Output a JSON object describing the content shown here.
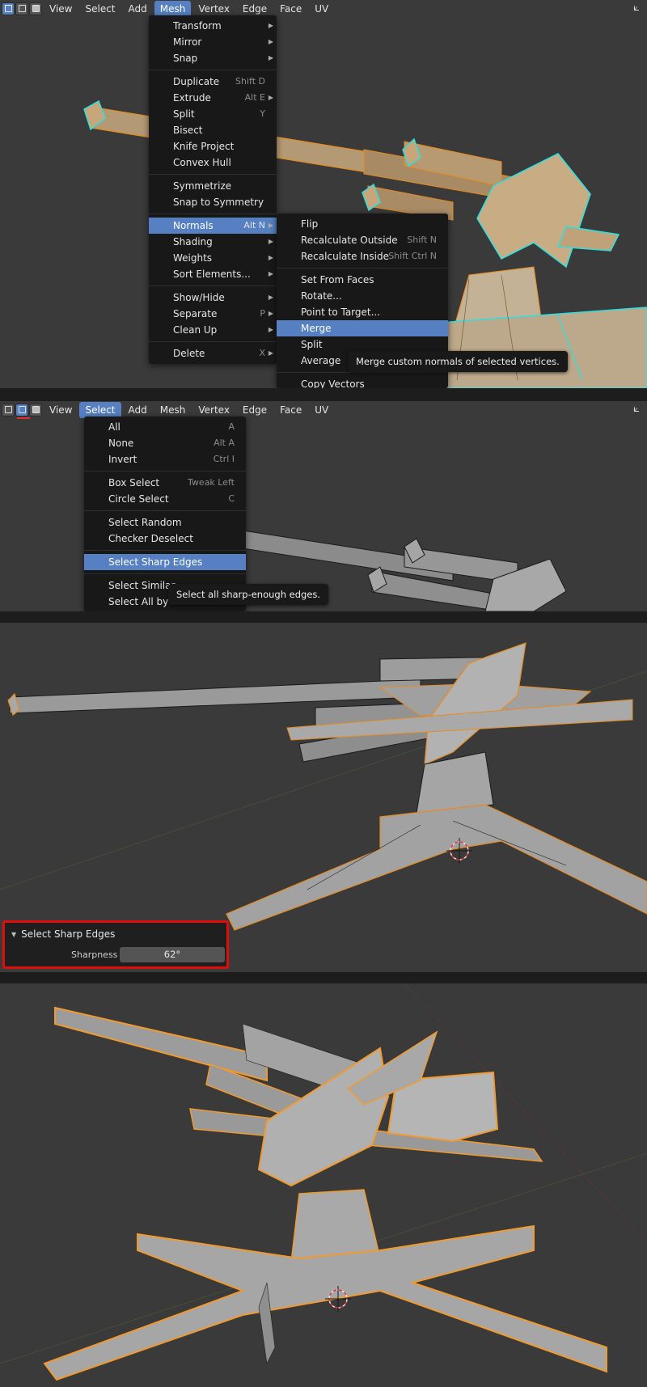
{
  "panel1": {
    "header_menus": [
      "View",
      "Select",
      "Add",
      "Mesh",
      "Vertex",
      "Edge",
      "Face",
      "UV"
    ],
    "open_menu": "Mesh",
    "mesh_menu": [
      {
        "label": "Transform",
        "shortcut": "",
        "submenu": true
      },
      {
        "label": "Mirror",
        "shortcut": "",
        "submenu": true
      },
      {
        "label": "Snap",
        "shortcut": "",
        "submenu": true
      },
      {
        "sep": true
      },
      {
        "label": "Duplicate",
        "shortcut": "Shift D",
        "submenu": false
      },
      {
        "label": "Extrude",
        "shortcut": "Alt E",
        "submenu": true
      },
      {
        "label": "Split",
        "shortcut": "Y",
        "submenu": false
      },
      {
        "label": "Bisect",
        "shortcut": "",
        "submenu": false
      },
      {
        "label": "Knife Project",
        "shortcut": "",
        "submenu": false
      },
      {
        "label": "Convex Hull",
        "shortcut": "",
        "submenu": false
      },
      {
        "sep": true
      },
      {
        "label": "Symmetrize",
        "shortcut": "",
        "submenu": false
      },
      {
        "label": "Snap to Symmetry",
        "shortcut": "",
        "submenu": false
      },
      {
        "sep": true
      },
      {
        "label": "Normals",
        "shortcut": "Alt N",
        "submenu": true,
        "highlight": true
      },
      {
        "label": "Shading",
        "shortcut": "",
        "submenu": true
      },
      {
        "label": "Weights",
        "shortcut": "",
        "submenu": true
      },
      {
        "label": "Sort Elements...",
        "shortcut": "",
        "submenu": true
      },
      {
        "sep": true
      },
      {
        "label": "Show/Hide",
        "shortcut": "",
        "submenu": true
      },
      {
        "label": "Separate",
        "shortcut": "P",
        "submenu": true
      },
      {
        "label": "Clean Up",
        "shortcut": "",
        "submenu": true
      },
      {
        "sep": true
      },
      {
        "label": "Delete",
        "shortcut": "X",
        "submenu": true
      }
    ],
    "normals_menu": [
      {
        "label": "Flip",
        "shortcut": ""
      },
      {
        "label": "Recalculate Outside",
        "shortcut": "Shift N"
      },
      {
        "label": "Recalculate Inside",
        "shortcut": "Shift Ctrl N"
      },
      {
        "sep": true
      },
      {
        "label": "Set From Faces",
        "shortcut": ""
      },
      {
        "label": "Rotate...",
        "shortcut": ""
      },
      {
        "label": "Point to Target...",
        "shortcut": ""
      },
      {
        "label": "Merge",
        "shortcut": "",
        "highlight": true
      },
      {
        "label": "Split",
        "shortcut": ""
      },
      {
        "label": "Average",
        "shortcut": ""
      },
      {
        "sep": true
      },
      {
        "label": "Copy Vectors",
        "shortcut": ""
      }
    ],
    "tooltip": "Merge custom normals of selected vertices."
  },
  "panel2": {
    "header_menus": [
      "View",
      "Select",
      "Add",
      "Mesh",
      "Vertex",
      "Edge",
      "Face",
      "UV"
    ],
    "open_menu": "Select",
    "select_menu": [
      {
        "label": "All",
        "shortcut": "A"
      },
      {
        "label": "None",
        "shortcut": "Alt A"
      },
      {
        "label": "Invert",
        "shortcut": "Ctrl I"
      },
      {
        "sep": true
      },
      {
        "label": "Box Select",
        "shortcut": "Tweak Left"
      },
      {
        "label": "Circle Select",
        "shortcut": "C"
      },
      {
        "sep": true
      },
      {
        "label": "Select Random",
        "shortcut": ""
      },
      {
        "label": "Checker Deselect",
        "shortcut": ""
      },
      {
        "sep": true
      },
      {
        "label": "Select Sharp Edges",
        "shortcut": "",
        "highlight": true
      },
      {
        "sep": true
      },
      {
        "label": "Select Similar",
        "shortcut": ""
      },
      {
        "label": "Select All by Trait",
        "shortcut": "",
        "submenu": true
      }
    ],
    "tooltip": "Select all sharp-enough edges."
  },
  "panel3": {
    "operator_title": "Select Sharp Edges",
    "sharpness_label": "Sharpness",
    "sharpness_value": "62°"
  },
  "colors": {
    "viewport_bg": "#3a3a3a",
    "menu_bg": "#181818",
    "highlight": "#5680c2",
    "selection_orange": "#f29a2e",
    "vertex_cyan": "#2ce0e0",
    "annotation_red": "#e00d0d"
  }
}
